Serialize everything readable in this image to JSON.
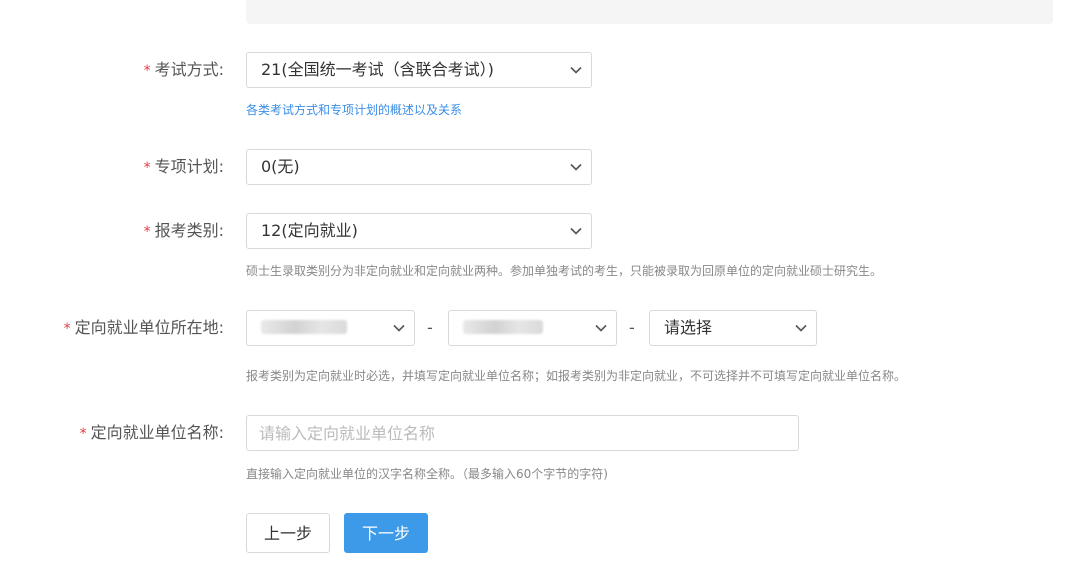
{
  "form": {
    "exam_mode": {
      "label": "考试方式:",
      "required_mark": "*",
      "value": "21(全国统一考试（含联合考试）)",
      "link_text": "各类考试方式和专项计划的概述以及关系"
    },
    "special_plan": {
      "label": "专项计划:",
      "required_mark": "*",
      "value": "0(无)"
    },
    "category": {
      "label": "报考类别:",
      "required_mark": "*",
      "value": "12(定向就业)",
      "hint": "硕士生录取类别分为非定向就业和定向就业两种。参加单独考试的考生，只能被录取为回原单位的定向就业硕士研究生。"
    },
    "unit_location": {
      "label": "定向就业单位所在地:",
      "required_mark": "*",
      "separator": "-",
      "province_value": "",
      "city_value": "",
      "district_value": "请选择",
      "hint": "报考类别为定向就业时必选，并填写定向就业单位名称；如报考类别为非定向就业，不可选择并不可填写定向就业单位名称。"
    },
    "unit_name": {
      "label": "定向就业单位名称:",
      "required_mark": "*",
      "value": "",
      "placeholder": "请输入定向就业单位名称",
      "hint": "直接输入定向就业单位的汉字名称全称。（最多输入60个字节的字符)"
    }
  },
  "buttons": {
    "prev_label": "上一步",
    "next_label": "下一步"
  },
  "colors": {
    "required": "#e4393c",
    "link": "#3a8ee6",
    "primary_button": "#3c9ae8"
  }
}
